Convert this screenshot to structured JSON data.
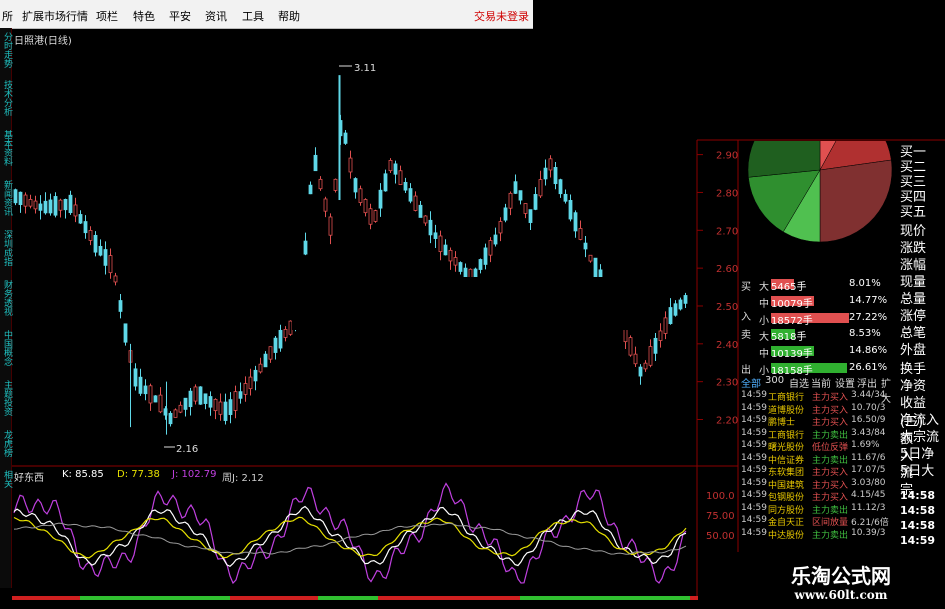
{
  "menu": {
    "items": [
      "所",
      "扩展市场行情",
      "项栏",
      "特色",
      "平安",
      "资讯",
      "工具",
      "帮助"
    ],
    "login": "交易未登录"
  },
  "vtabs": [
    "分时走势",
    "技术分析",
    "基本资料",
    "新闻资讯",
    "深圳成指",
    "财务透视",
    "中国概念",
    "主题投资",
    "龙虎榜",
    "相关"
  ],
  "stock": {
    "title": "日照港(日线)"
  },
  "price_chart": {
    "type": "candlestick",
    "high_label": "3.11",
    "low_label": "2.16",
    "axis_ticks": [
      "2.90",
      "2.80",
      "2.70",
      "2.60",
      "2.50",
      "2.40",
      "2.30",
      "2.20"
    ],
    "ylim": [
      2.13,
      3.15
    ],
    "up_color": "#e05050",
    "down_color": "#5fd8e8"
  },
  "indicator": {
    "name": "好东西",
    "k_label": "K: 85.85",
    "d_label": "D: 77.38",
    "j_label": "J: 102.79",
    "extra_label": "周J: 2.12",
    "axis_ticks": [
      "100.0",
      "75.00",
      "50.00"
    ],
    "line_colors": {
      "k": "#ffffff",
      "d": "#e6e000",
      "j": "#c040e0"
    }
  },
  "pie": {
    "slices": [
      {
        "label": "大买",
        "value": 8.01,
        "color": "#e05050"
      },
      {
        "label": "中买",
        "value": 14.77,
        "color": "#b03030"
      },
      {
        "label": "小买",
        "value": 27.22,
        "color": "#803030"
      },
      {
        "label": "大卖",
        "value": 8.53,
        "color": "#50c050"
      },
      {
        "label": "中卖",
        "value": 14.86,
        "color": "#2f8f2f"
      },
      {
        "label": "小卖",
        "value": 26.61,
        "color": "#1f5f1f"
      }
    ]
  },
  "quote_labels": [
    "买一",
    "买二",
    "买三",
    "买四",
    "买五",
    "现价",
    "涨跌",
    "涨幅",
    "现量",
    "总量",
    "涨停",
    "总笔",
    "外盘",
    "换手",
    "净资",
    "收益(三)",
    "净流入额",
    "大宗流入",
    "5日净流",
    "5日大宗"
  ],
  "order_flow": {
    "buy": {
      "title": [
        "买",
        "入"
      ],
      "rows": [
        {
          "size": "大",
          "vol": "5465手",
          "pct": "8.01%",
          "bar": 0.3
        },
        {
          "size": "中",
          "vol": "10079手",
          "pct": "14.77%",
          "bar": 0.55
        },
        {
          "size": "小",
          "vol": "18572手",
          "pct": "27.22%",
          "bar": 1.0
        }
      ]
    },
    "sell": {
      "title": [
        "卖",
        "出"
      ],
      "rows": [
        {
          "size": "大",
          "vol": "5818手",
          "pct": "8.53%",
          "bar": 0.31
        },
        {
          "size": "中",
          "vol": "10139手",
          "pct": "14.86%",
          "bar": 0.55
        },
        {
          "size": "小",
          "vol": "18158手",
          "pct": "26.61%",
          "bar": 0.98
        }
      ]
    }
  },
  "tabs": [
    "全部",
    "300",
    "自选",
    "当前",
    "设置",
    "浮出",
    "扩大"
  ],
  "ticks": [
    {
      "time": "14:59",
      "name": "工商银行",
      "action": "主力买入",
      "value": "3.44/34",
      "buy": true
    },
    {
      "time": "14:59",
      "name": "道博股份",
      "action": "主力买入",
      "value": "10.70/3",
      "buy": true
    },
    {
      "time": "14:59",
      "name": "鹏博士",
      "action": "主力买入",
      "value": "16.50/9",
      "buy": true
    },
    {
      "time": "14:59",
      "name": "工商银行",
      "action": "主力卖出",
      "value": "3.43/84",
      "buy": false
    },
    {
      "time": "14:59",
      "name": "曙光股份",
      "action": "低位反弹",
      "value": "1.69%",
      "buy": true
    },
    {
      "time": "14:59",
      "name": "中信证券",
      "action": "主力卖出",
      "value": "11.67/6",
      "buy": false
    },
    {
      "time": "14:59",
      "name": "东软集团",
      "action": "主力买入",
      "value": "17.07/5",
      "buy": true
    },
    {
      "time": "14:59",
      "name": "中国建筑",
      "action": "主力买入",
      "value": "3.03/80",
      "buy": true
    },
    {
      "time": "14:59",
      "name": "包钢股份",
      "action": "主力买入",
      "value": "4.15/45",
      "buy": true
    },
    {
      "time": "14:59",
      "name": "同方股份",
      "action": "主力卖出",
      "value": "11.12/3",
      "buy": false
    },
    {
      "time": "14:59",
      "name": "金自天正",
      "action": "区间放量",
      "value": "6.21/6倍",
      "buy": true
    },
    {
      "time": "14:59",
      "name": "中达股份",
      "action": "主力卖出",
      "value": "10.39/3",
      "buy": false
    }
  ],
  "times_col": [
    "14:58",
    "14:58",
    "14:58",
    "14:59"
  ],
  "watermark": {
    "title": "乐淘公式网",
    "url": "www.60lt.com"
  }
}
